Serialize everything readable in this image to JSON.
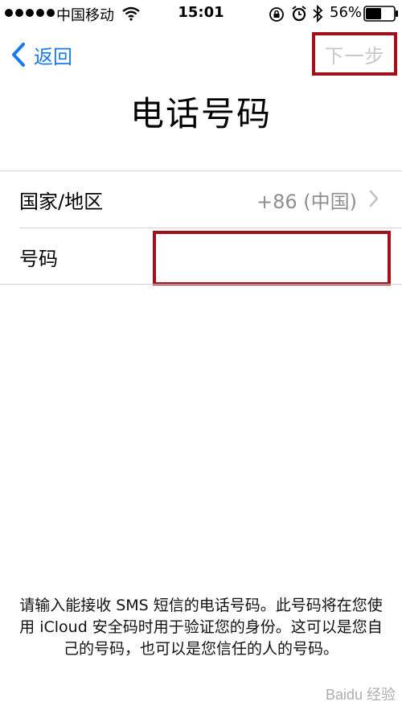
{
  "status_bar": {
    "carrier": "中国移动",
    "time": "15:01",
    "battery_percent": "56%",
    "battery_level": 0.56,
    "icons": [
      "signal-dots-icon",
      "wifi-icon",
      "orientation-lock-icon",
      "alarm-icon",
      "bluetooth-icon",
      "battery-icon"
    ]
  },
  "nav": {
    "back_label": "返回",
    "next_label": "下一步"
  },
  "title": "电话号码",
  "form": {
    "country_label": "国家/地区",
    "country_value": "+86 (中国)",
    "number_label": "号码",
    "number_value": "",
    "number_placeholder": ""
  },
  "footer_text": "请输入能接收 SMS 短信的电话号码。此号码将在您使用 iCloud 安全码时用于验证您的身份。这可以是您自己的号码，也可以是您信任的人的号码。",
  "watermark": "Baidu 经验",
  "colors": {
    "accent": "#1a7af0",
    "highlight_border": "#a30f1b",
    "disabled_text": "#c8c8c8",
    "secondary_text": "#8e8e93"
  }
}
